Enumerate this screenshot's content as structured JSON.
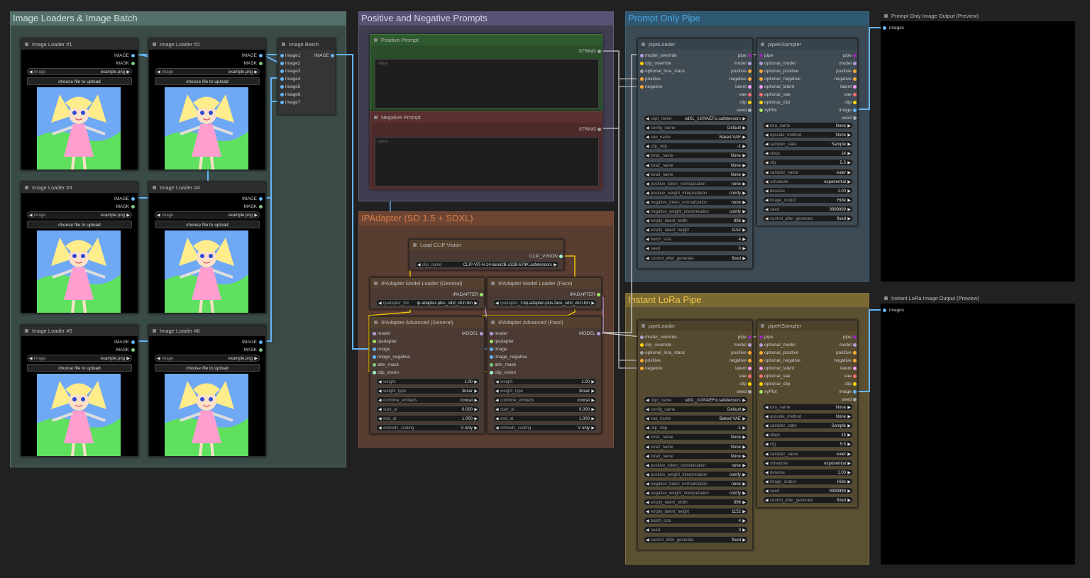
{
  "groups": {
    "g1": "Image Loaders & Image Batch",
    "g2": "Positive and Negative Prompts",
    "g3": "Prompt Only Pipe",
    "g4": "IPAdapter (SD 1.5 + SDXL)",
    "g5": "Instant LoRa Pipe"
  },
  "loaders": {
    "titles": [
      "Image Loader #1",
      "Image Loader #2",
      "Image Loader #3",
      "Image Loader #4",
      "Image Loader #5",
      "Image Loader #6"
    ],
    "out_image": "IMAGE",
    "out_mask": "MASK",
    "w_label": "image",
    "w_value": "example.png",
    "upload": "choose file to upload"
  },
  "batch": {
    "title": "Image Batch",
    "inputs": [
      "image1",
      "image2",
      "image3",
      "image4",
      "image5",
      "image6",
      "image7"
    ],
    "output": "IMAGE"
  },
  "pos": {
    "title": "Positive Prompt",
    "output": "STRING",
    "placeholder": "value"
  },
  "neg": {
    "title": "Negative Prompt",
    "output": "STRING",
    "placeholder": "value"
  },
  "clipvision": {
    "title": "Load CLIP Vision",
    "output": "CLIP_VISION",
    "w_label": "clip_name",
    "w_value": "CLIP-ViT-H-14-laion2B-s32B-b79K.safetensors"
  },
  "iploader_gen": {
    "title": "IPAdapter Model Loader (General)",
    "output": "IPADAPTER",
    "w_label": "ipadapter_file",
    "w_value": "ip-adapter-plus_sdxl_vit-h.bin"
  },
  "iploader_face": {
    "title": "IPAdapter Model Loader (Face)",
    "output": "IPADAPTER",
    "w_label": "ipadapter_file",
    "w_value": "ip-adapter-plus-face_sdxl_vit-h.bin"
  },
  "ipadv": {
    "title_gen": "IPAdapter Advanced (General)",
    "title_face": "IPAdapter Advanced (Face)",
    "inputs": [
      "model",
      "ipadapter",
      "image",
      "image_negative",
      "attn_mask",
      "clip_vision"
    ],
    "output": "MODEL",
    "widgets": [
      [
        "weight",
        "1.00"
      ],
      [
        "weight_type",
        "linear"
      ],
      [
        "combine_embeds",
        "concat"
      ],
      [
        "start_at",
        "0.000"
      ],
      [
        "end_at",
        "1.000"
      ],
      [
        "embeds_scaling",
        "V only"
      ]
    ]
  },
  "pipeloader": {
    "title": "pipeLoader",
    "inputs": [
      "model_override",
      "clip_override",
      "optional_lora_stack",
      "positive",
      "negative"
    ],
    "outputs": [
      "pipe",
      "model",
      "positive",
      "negative",
      "latent",
      "vae",
      "clip",
      "seed"
    ],
    "widgets": [
      [
        "ckpt_name",
        "sdXL_v10VAEFix.safetensors"
      ],
      [
        "config_name",
        "Default"
      ],
      [
        "vae_name",
        "Baked VAE"
      ],
      [
        "clip_skip",
        "-1"
      ],
      [
        "lora1_name",
        "None"
      ],
      [
        "lora2_name",
        "None"
      ],
      [
        "lora3_name",
        "None"
      ],
      [
        "positive_token_normalization",
        "none"
      ],
      [
        "positive_weight_interpretation",
        "comfy"
      ],
      [
        "negative_token_normalization",
        "none"
      ],
      [
        "negative_weight_interpretation",
        "comfy"
      ],
      [
        "empty_latent_width",
        "896"
      ],
      [
        "empty_latent_height",
        "1152"
      ],
      [
        "batch_size",
        "4"
      ],
      [
        "seed",
        "0"
      ],
      [
        "control_after_generate",
        "fixed"
      ]
    ]
  },
  "pipeksampler": {
    "title": "pipeKSampler",
    "inputs": [
      "pipe",
      "optional_model",
      "optional_positive",
      "optional_negative",
      "optional_latent",
      "optional_vae",
      "optional_clip",
      "xyPlot"
    ],
    "outputs": [
      "pipe",
      "model",
      "positive",
      "negative",
      "latent",
      "vae",
      "clip",
      "image",
      "seed"
    ],
    "widgets": [
      [
        "lora_name",
        "None"
      ],
      [
        "upscale_method",
        "None"
      ],
      [
        "sampler_state",
        "Sample"
      ],
      [
        "steps",
        "14"
      ],
      [
        "cfg",
        "5.5"
      ],
      [
        "sampler_name",
        "euler"
      ],
      [
        "scheduler",
        "exponential"
      ],
      [
        "denoise",
        "1.00"
      ],
      [
        "image_output",
        "Hide"
      ],
      [
        "seed",
        "9999999"
      ],
      [
        "control_after_generate",
        "fixed"
      ]
    ]
  },
  "out1": {
    "title": "Prompt Only Image Output (Preview)",
    "input": "images"
  },
  "out2": {
    "title": "Instant LoRa Image Output (Preview)",
    "input": "images"
  },
  "colors": {
    "wire_image": "#64b5f6",
    "wire_clip": "#ffd500",
    "wire_string": "#9e9e9e",
    "model": "#b39ddb",
    "pipe": "#9c27b0"
  }
}
